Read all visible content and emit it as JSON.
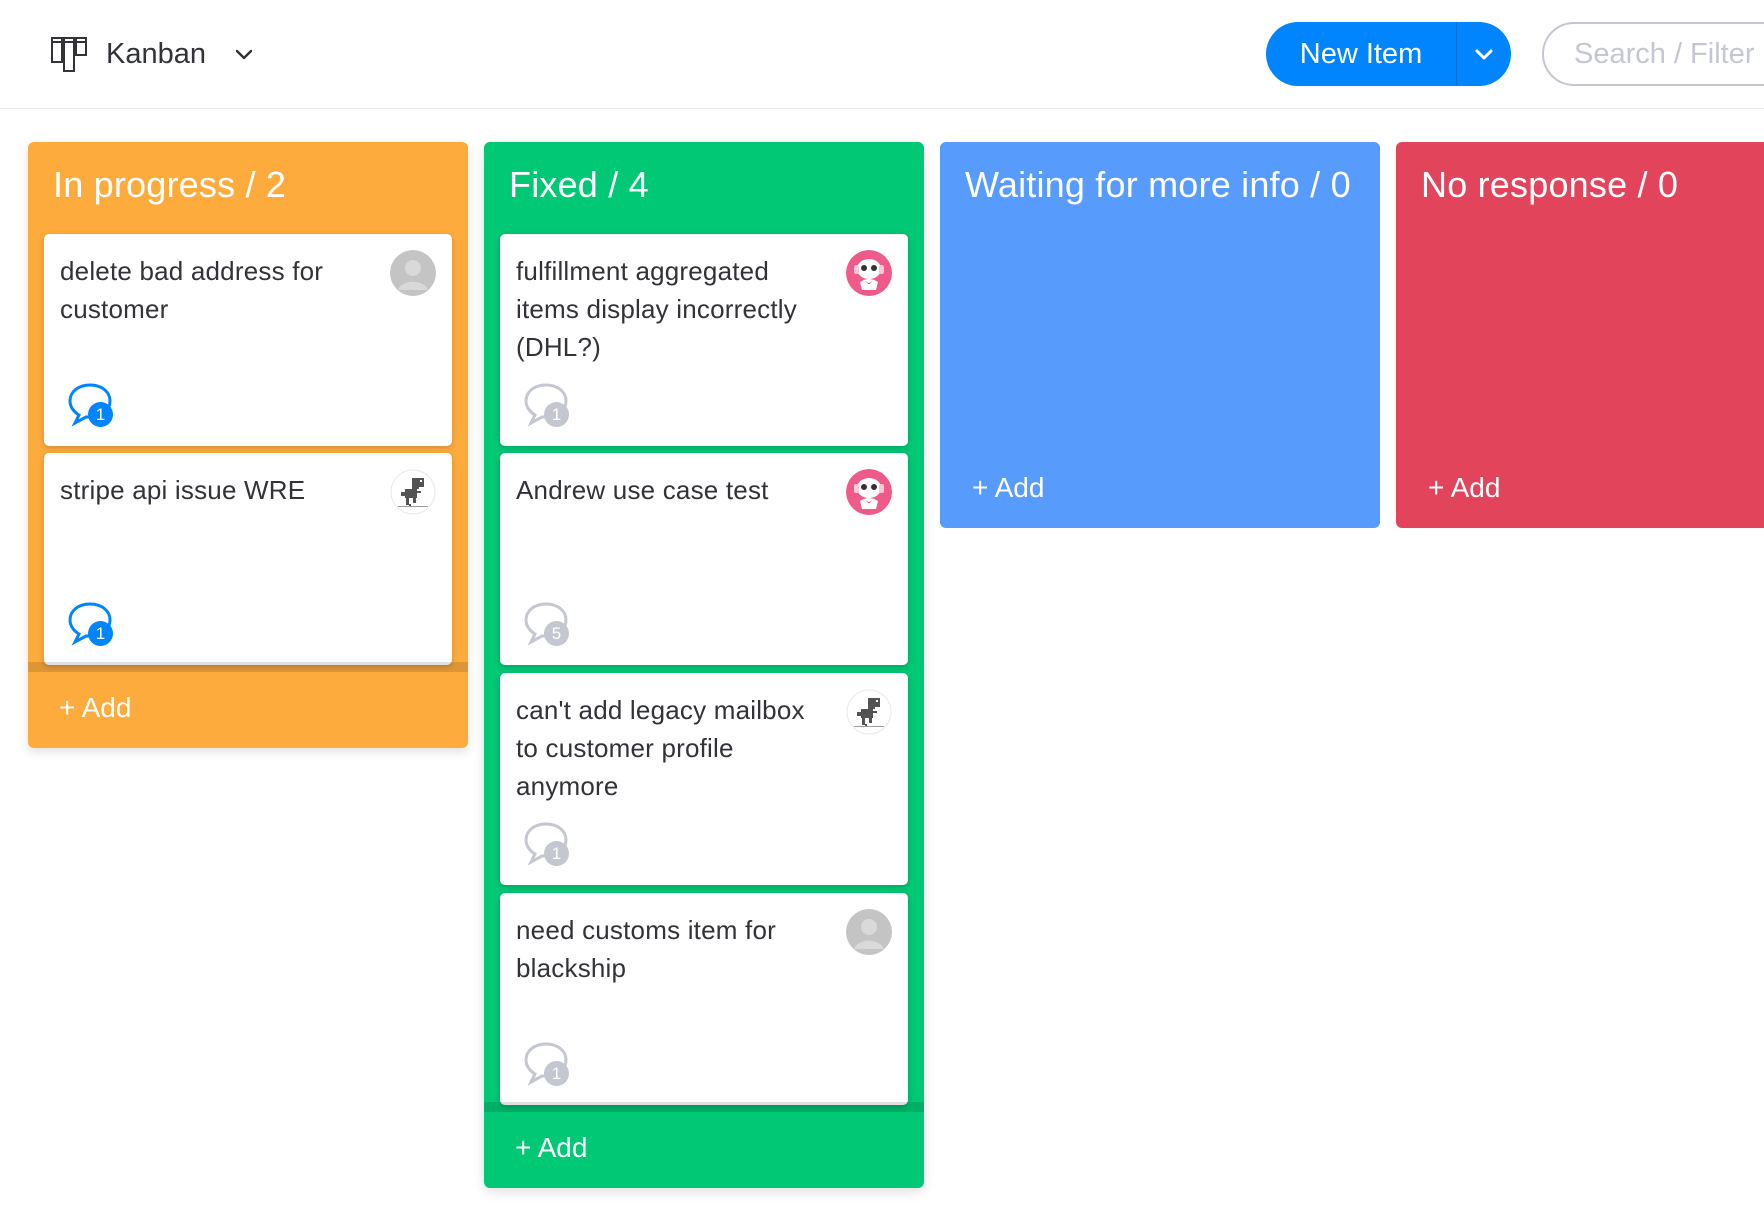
{
  "header": {
    "view_title": "Kanban",
    "new_item_label": "New Item",
    "search_placeholder": "Search / Filter"
  },
  "columns": [
    {
      "title": "In progress / 2",
      "color": "#fdab3d",
      "add_label": "+ Add",
      "cards": [
        {
          "title": "delete bad address for customer",
          "avatar": "default-avatar",
          "updates": "1",
          "updates_state": "active"
        },
        {
          "title": "stripe api issue WRE",
          "avatar": "dino-avatar",
          "updates": "1",
          "updates_state": "active"
        }
      ]
    },
    {
      "title": "Fixed / 4",
      "color": "#00c875",
      "add_label": "+ Add",
      "cards": [
        {
          "title": "fulfillment aggregated items display incorrectly (DHL?)",
          "avatar": "pink-robot-avatar",
          "updates": "1",
          "updates_state": "inactive"
        },
        {
          "title": "Andrew use case test",
          "avatar": "pink-robot-avatar",
          "updates": "5",
          "updates_state": "inactive"
        },
        {
          "title": "can't add legacy mailbox to customer profile anymore",
          "avatar": "dino-avatar",
          "updates": "1",
          "updates_state": "inactive"
        },
        {
          "title": "need customs item for blackship",
          "avatar": "default-avatar",
          "updates": "1",
          "updates_state": "inactive"
        }
      ]
    },
    {
      "title": "Waiting for more info / 0",
      "color": "#579bfc",
      "add_label": "+ Add",
      "cards": []
    },
    {
      "title": "No response / 0",
      "color": "#e2445c",
      "add_label": "+ Add",
      "cards": []
    }
  ]
}
